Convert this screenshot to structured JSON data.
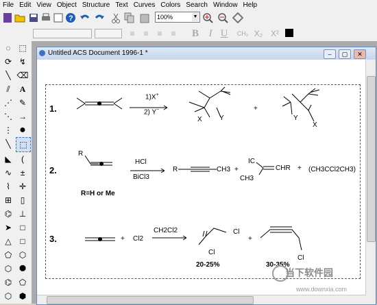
{
  "menu": [
    "File",
    "Edit",
    "View",
    "Object",
    "Structure",
    "Text",
    "Curves",
    "Colors",
    "Search",
    "Window",
    "Help"
  ],
  "toolbar": {
    "zoom_value": "100%"
  },
  "document": {
    "title": "Untitled ACS Document 1996-1 *"
  },
  "reactions": {
    "r1": {
      "number": "1.",
      "reagent1": "1)X",
      "reagent1_sup": "+",
      "reagent2": "2) Y",
      "reagent2_sup": "−",
      "x1": "X",
      "y1": "Y",
      "plus": "+",
      "y2": "Y",
      "x2": "X"
    },
    "r2": {
      "number": "2.",
      "r_start": "R",
      "reagent_top": "HCl",
      "reagent_bottom": "BiCl3",
      "r_prod": "R",
      "ch3": "CH3",
      "plus1": "+",
      "ic": "IC",
      "chr": "CHR",
      "ch3b": "CH3",
      "plus2": "+",
      "prod3": "(CH3CCl2CH3)",
      "note": "R=H or Me"
    },
    "r3": {
      "number": "3.",
      "plus1": "+",
      "cl2": "Cl2",
      "reagent": "CH2Cl2",
      "cl_a": "Cl",
      "cl_b": "Cl",
      "yield1": "20-25%",
      "plus2": "+",
      "cl_c": "Cl",
      "yield2": "30-35%"
    }
  },
  "watermark": {
    "text": "当下软件园",
    "url": "www.downxia.com"
  },
  "colors": {
    "accent": "#3b73c9",
    "title_bar": "#c6d6ec"
  }
}
